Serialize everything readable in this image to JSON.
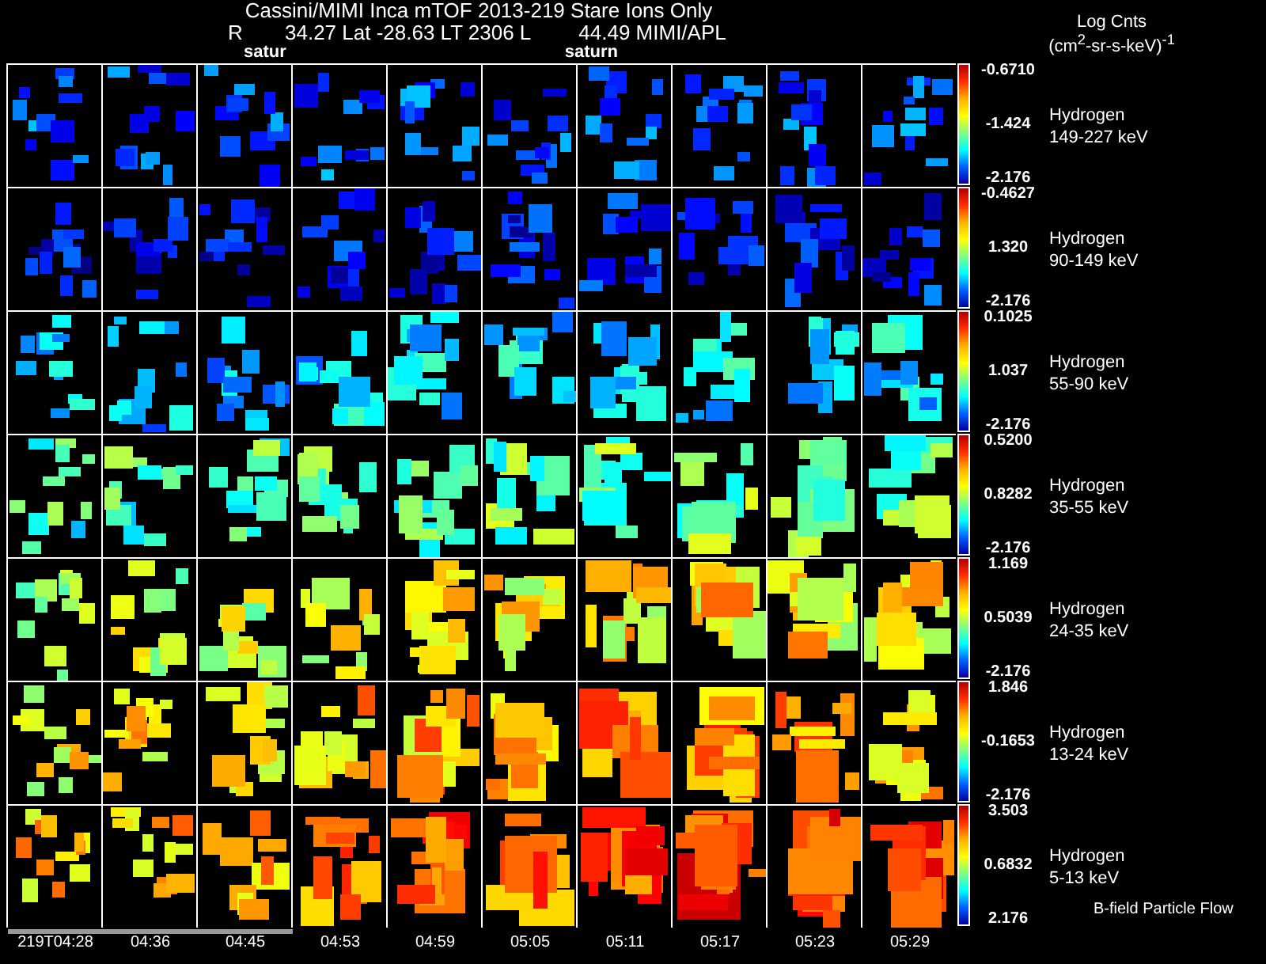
{
  "header": {
    "title": "Cassini/MIMI Inca mTOF  2013-219   Stare   Ions Only",
    "position_label": "R",
    "position": "34.27 Lat -28.63 LT 2306 L",
    "position_tail": "44.49  MIMI/APL",
    "markers": [
      "satur",
      "saturn"
    ]
  },
  "units": {
    "title": "Log Cnts",
    "unit": "(cm$^{2}$-sr-s-keV)$^{-1}$"
  },
  "rows": [
    {
      "species": "Hydrogen",
      "energy": "149-227 keV",
      "scale_max": "-0.6710",
      "scale_mid": "-1.424",
      "scale_min": "-2.176"
    },
    {
      "species": "Hydrogen",
      "energy": "90-149 keV",
      "scale_max": "-0.4627",
      "scale_mid": "1.320",
      "scale_min": "-2.176"
    },
    {
      "species": "Hydrogen",
      "energy": "55-90 keV",
      "scale_max": "0.1025",
      "scale_mid": "1.037",
      "scale_min": "-2.176"
    },
    {
      "species": "Hydrogen",
      "energy": "35-55 keV",
      "scale_max": "0.5200",
      "scale_mid": "0.8282",
      "scale_min": "-2.176"
    },
    {
      "species": "Hydrogen",
      "energy": "24-35 keV",
      "scale_max": "1.169",
      "scale_mid": "0.5039",
      "scale_min": "-2.176"
    },
    {
      "species": "Hydrogen",
      "energy": "13-24 keV",
      "scale_max": "1.846",
      "scale_mid": "-0.1653",
      "scale_min": "-2.176"
    },
    {
      "species": "Hydrogen",
      "energy": "5-13 keV",
      "scale_max": "3.503",
      "scale_mid": "0.6832",
      "scale_min": "2.176"
    }
  ],
  "footnote": "B-field Particle Flow",
  "times": [
    "219T04:28",
    "04:36",
    "04:45",
    "04:53",
    "04:59",
    "05:05",
    "05:11",
    "05:17",
    "05:23",
    "05:29"
  ]
}
